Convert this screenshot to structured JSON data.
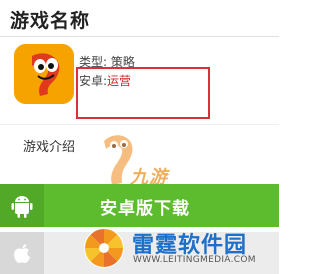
{
  "header": {
    "title": "游戏名称"
  },
  "app": {
    "icon": "app-mascot-icon",
    "type_label": "类型: 策略",
    "os_label": "安卓:",
    "os_value": "运营"
  },
  "intro": {
    "label": "游戏介绍"
  },
  "watermark": {
    "text": "九游"
  },
  "android": {
    "label": "安卓版下载",
    "icon": "android-icon"
  },
  "ios": {
    "icon": "apple-icon"
  },
  "brand": {
    "name": "雷霆软件园",
    "url": "WWW.LEITINGMEDIA.COM"
  },
  "colors": {
    "android_green": "#5dbb2e",
    "highlight_red": "#d9313c",
    "brand_blue": "#1e6fc7",
    "icon_orange": "#f6a300"
  }
}
